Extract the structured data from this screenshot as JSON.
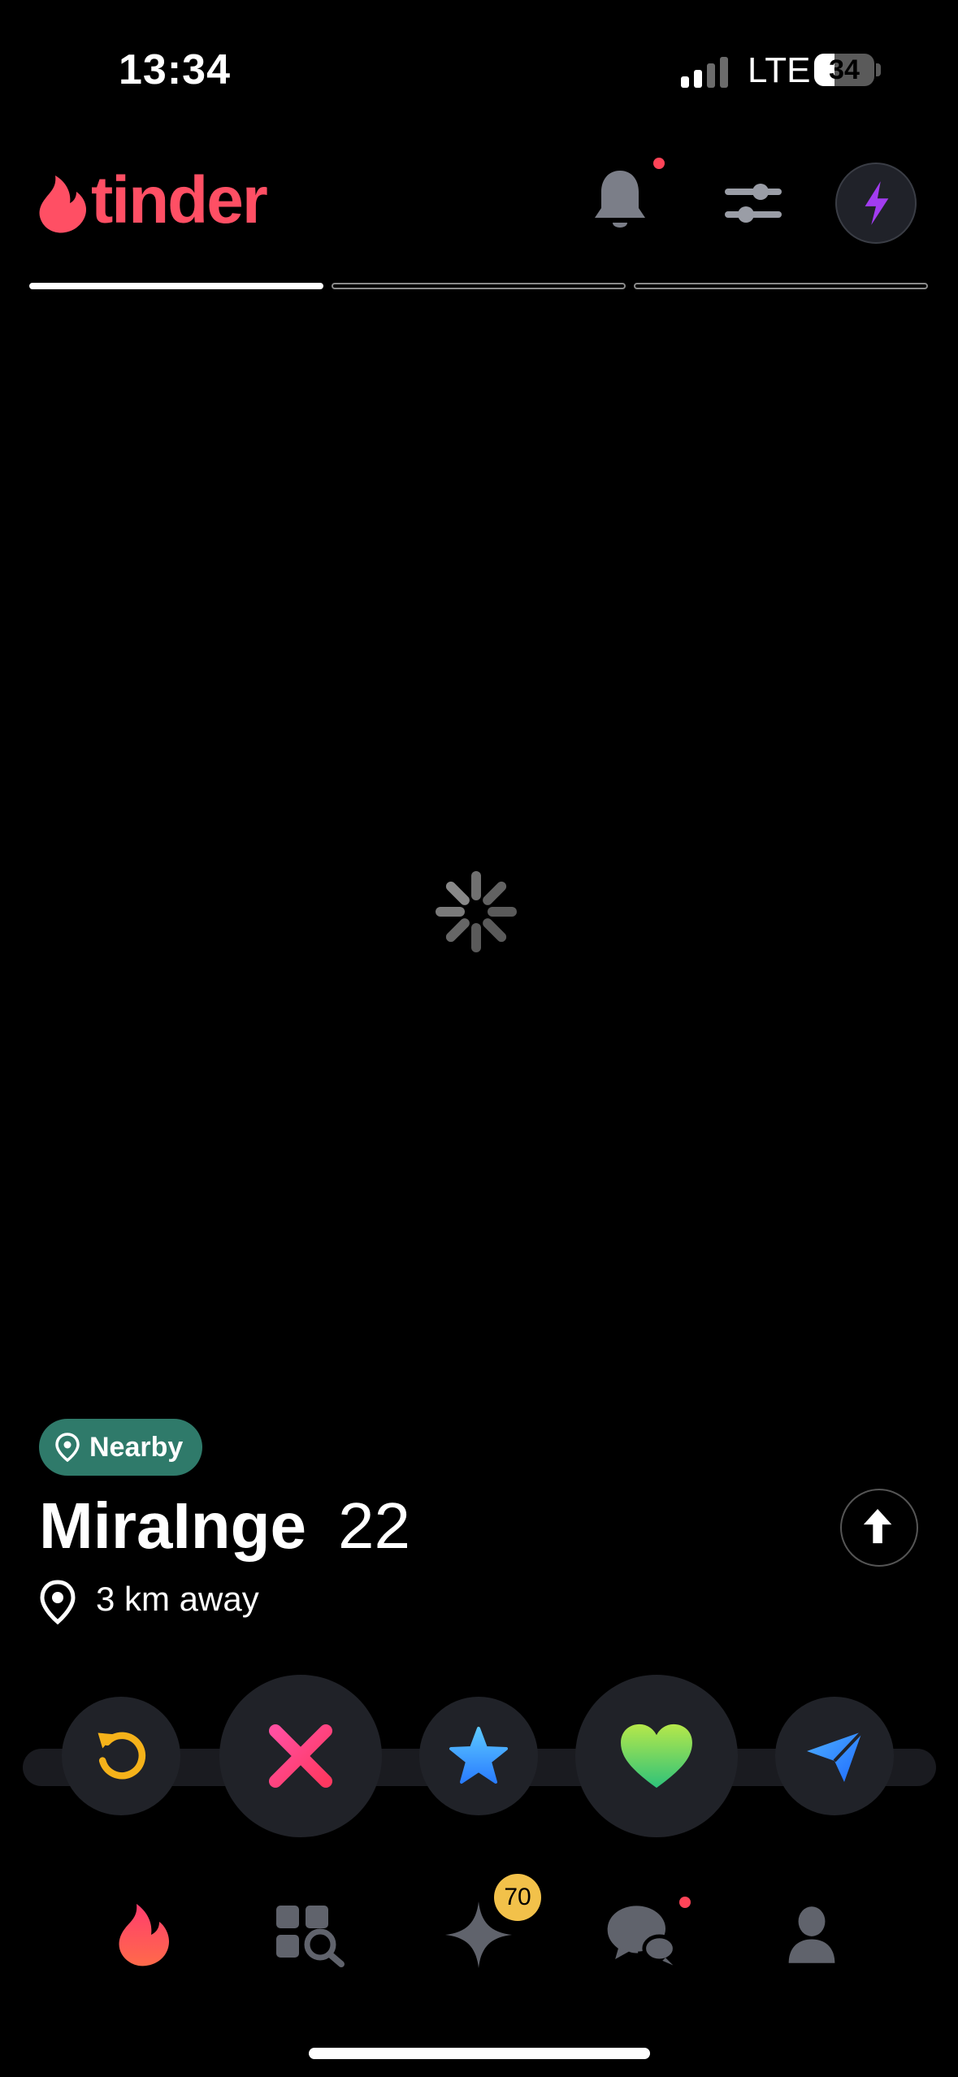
{
  "status_bar": {
    "time": "13:34",
    "network": "LTE",
    "battery": "34"
  },
  "header": {
    "logo_text": "tinder",
    "brand_color": "#ff4f64",
    "icons": [
      "bell-icon",
      "sliders-icon",
      "lightning-icon"
    ]
  },
  "photo_progress": {
    "total": 3,
    "current": 1
  },
  "profile": {
    "badge": "Nearby",
    "name": "MiraInge",
    "age": "22",
    "distance": "3 km away"
  },
  "actions": [
    "rewind-button",
    "nope-button",
    "super-like-button",
    "like-button",
    "message-button"
  ],
  "tabs": {
    "items": [
      "tab-discover",
      "tab-explore",
      "tab-gold",
      "tab-chat",
      "tab-profile"
    ],
    "gold_count": "70"
  }
}
